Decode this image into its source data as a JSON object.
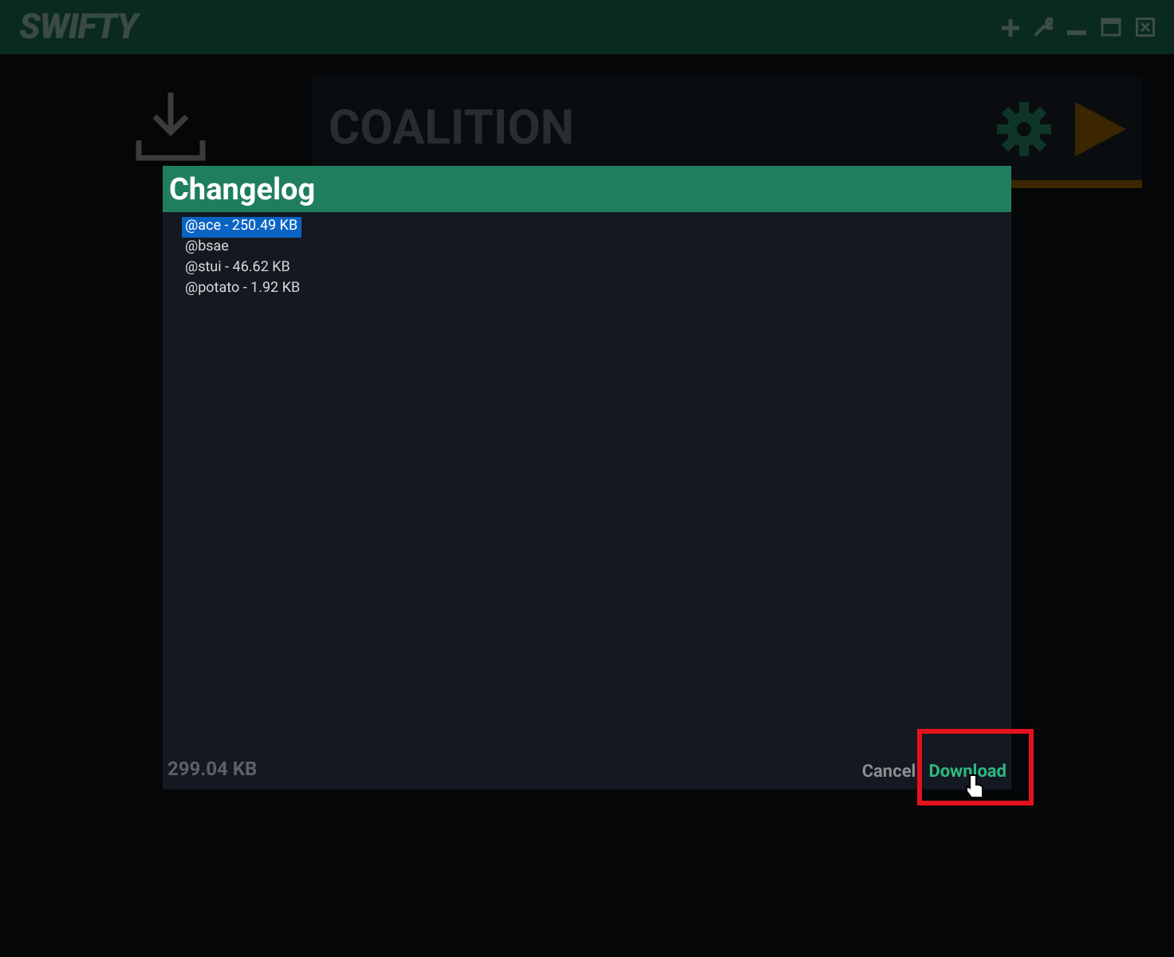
{
  "app": {
    "title": "SWIFTY",
    "game": {
      "name": "COALITION"
    }
  },
  "dialog": {
    "title": "Changelog",
    "items": [
      {
        "label": "@ace - 250.49 KB",
        "selected": true
      },
      {
        "label": "@bsae",
        "selected": false
      },
      {
        "label": "@stui - 46.62 KB",
        "selected": false
      },
      {
        "label": "@potato - 1.92 KB",
        "selected": false
      }
    ],
    "total": "299.04 KB",
    "buttons": [
      {
        "label": "Cancel",
        "kind": "secondary",
        "highlighted": false
      },
      {
        "label": "Download",
        "kind": "primary",
        "highlighted": true
      }
    ]
  }
}
